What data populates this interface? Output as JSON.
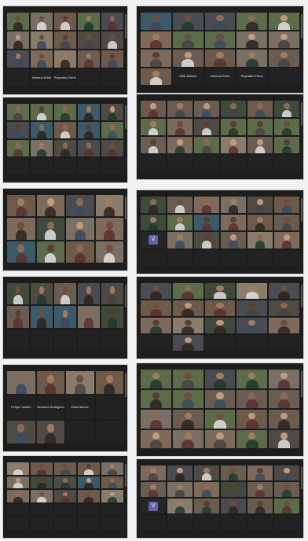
{
  "panels": [
    {
      "id": "p1",
      "cols": 5,
      "rows": 4,
      "tiles": [
        {
          "name": ""
        },
        {
          "name": ""
        },
        {
          "name": ""
        },
        {
          "name": ""
        },
        {
          "name": ""
        },
        {
          "name": ""
        },
        {
          "name": ""
        },
        {
          "name": ""
        },
        {
          "name": ""
        },
        {
          "name": ""
        },
        {
          "name": ""
        },
        {
          "name": ""
        },
        {
          "name": ""
        },
        {
          "name": ""
        },
        {
          "name": ""
        },
        {
          "name": "",
          "style": "dark"
        },
        {
          "name": "Nnenna Edeh",
          "style": "dark"
        },
        {
          "name": "Reynaldo Fierro",
          "style": "dark"
        },
        {
          "name": "",
          "style": "dark"
        },
        {
          "name": "",
          "style": "dark"
        }
      ],
      "caption": ""
    },
    {
      "id": "p2",
      "cols": 5,
      "rows": 4,
      "tiles": [
        {
          "name": ""
        },
        {
          "name": ""
        },
        {
          "name": ""
        },
        {
          "name": ""
        },
        {
          "name": ""
        },
        {
          "name": ""
        },
        {
          "name": ""
        },
        {
          "name": ""
        },
        {
          "name": ""
        },
        {
          "name": ""
        },
        {
          "name": ""
        },
        {
          "name": ""
        },
        {
          "name": ""
        },
        {
          "name": ""
        },
        {
          "name": ""
        },
        {
          "name": ""
        },
        {
          "name": "Gleb Azimov",
          "style": "dark"
        },
        {
          "name": "Nnenna Edeh",
          "style": "dark"
        },
        {
          "name": "Reynaldo Fierro",
          "style": "dark"
        },
        {
          "name": "",
          "style": "dark"
        }
      ],
      "caption": ""
    },
    {
      "id": "p3",
      "cols": 5,
      "rows": 4,
      "tiles": [
        {
          "name": ""
        },
        {
          "name": ""
        },
        {
          "name": ""
        },
        {
          "name": ""
        },
        {
          "name": ""
        },
        {
          "name": ""
        },
        {
          "name": ""
        },
        {
          "name": ""
        },
        {
          "name": ""
        },
        {
          "name": ""
        },
        {
          "name": ""
        },
        {
          "name": ""
        },
        {
          "name": ""
        },
        {
          "name": ""
        },
        {
          "name": ""
        },
        {
          "name": "",
          "style": "dark"
        },
        {
          "name": "",
          "style": "dark"
        },
        {
          "name": "",
          "style": "dark"
        },
        {
          "name": "",
          "style": "dark"
        },
        {
          "name": "",
          "style": "dark"
        }
      ],
      "caption": ""
    },
    {
      "id": "p4",
      "cols": 6,
      "rows": 4,
      "tiles": [
        {
          "name": ""
        },
        {
          "name": ""
        },
        {
          "name": ""
        },
        {
          "name": ""
        },
        {
          "name": ""
        },
        {
          "name": ""
        },
        {
          "name": ""
        },
        {
          "name": ""
        },
        {
          "name": ""
        },
        {
          "name": ""
        },
        {
          "name": ""
        },
        {
          "name": ""
        },
        {
          "name": ""
        },
        {
          "name": ""
        },
        {
          "name": ""
        },
        {
          "name": ""
        },
        {
          "name": ""
        },
        {
          "name": ""
        },
        {
          "name": "",
          "style": "dark"
        },
        {
          "name": "",
          "style": "dark"
        },
        {
          "name": "",
          "style": "dark"
        },
        {
          "name": "",
          "style": "dark"
        },
        {
          "name": "",
          "style": "dark"
        },
        {
          "name": "",
          "style": "dark"
        }
      ],
      "caption": ""
    },
    {
      "id": "p5",
      "cols": 4,
      "rows": 3,
      "tiles": [
        {
          "name": ""
        },
        {
          "name": ""
        },
        {
          "name": ""
        },
        {
          "name": ""
        },
        {
          "name": ""
        },
        {
          "name": ""
        },
        {
          "name": ""
        },
        {
          "name": ""
        },
        {
          "name": ""
        },
        {
          "name": ""
        },
        {
          "name": ""
        },
        {
          "name": ""
        }
      ],
      "caption": ""
    },
    {
      "id": "p6",
      "cols": 6,
      "rows": 4,
      "tiles": [
        {
          "name": ""
        },
        {
          "name": ""
        },
        {
          "name": ""
        },
        {
          "name": ""
        },
        {
          "name": ""
        },
        {
          "name": ""
        },
        {
          "name": ""
        },
        {
          "name": ""
        },
        {
          "name": ""
        },
        {
          "name": ""
        },
        {
          "name": ""
        },
        {
          "name": ""
        },
        {
          "name": "",
          "style": "avatar",
          "badge": "V"
        },
        {
          "name": ""
        },
        {
          "name": ""
        },
        {
          "name": ""
        },
        {
          "name": ""
        },
        {
          "name": ""
        },
        {
          "name": "",
          "style": "dark"
        },
        {
          "name": "",
          "style": "dark"
        },
        {
          "name": "",
          "style": "dark"
        },
        {
          "name": "",
          "style": "dark"
        },
        {
          "name": "",
          "style": "dark"
        },
        {
          "name": "",
          "style": "dark"
        }
      ],
      "caption": ""
    },
    {
      "id": "p7",
      "cols": 5,
      "rows": 3,
      "tiles": [
        {
          "name": ""
        },
        {
          "name": ""
        },
        {
          "name": ""
        },
        {
          "name": ""
        },
        {
          "name": ""
        },
        {
          "name": ""
        },
        {
          "name": ""
        },
        {
          "name": ""
        },
        {
          "name": ""
        },
        {
          "name": ""
        },
        {
          "name": "",
          "style": "dark"
        },
        {
          "name": "",
          "style": "dark"
        },
        {
          "name": "",
          "style": "dark"
        },
        {
          "name": "",
          "style": "dark"
        },
        {
          "name": "",
          "style": "dark"
        }
      ],
      "caption": ""
    },
    {
      "id": "p8",
      "cols": 5,
      "rows": 4,
      "tiles": [
        {
          "name": ""
        },
        {
          "name": ""
        },
        {
          "name": ""
        },
        {
          "name": ""
        },
        {
          "name": ""
        },
        {
          "name": ""
        },
        {
          "name": ""
        },
        {
          "name": ""
        },
        {
          "name": ""
        },
        {
          "name": ""
        },
        {
          "name": ""
        },
        {
          "name": ""
        },
        {
          "name": ""
        },
        {
          "name": ""
        },
        {
          "name": ""
        },
        {
          "name": "",
          "style": "dark"
        },
        {
          "name": ""
        },
        {
          "name": "",
          "style": "dark"
        },
        {
          "name": "",
          "style": "dark"
        },
        {
          "name": "",
          "style": "dark"
        }
      ],
      "caption": ""
    },
    {
      "id": "p9",
      "cols": 4,
      "rows": 3,
      "tiles": [
        {
          "name": ""
        },
        {
          "name": ""
        },
        {
          "name": ""
        },
        {
          "name": ""
        },
        {
          "name": "Felipe Castillo",
          "style": "dark"
        },
        {
          "name": "Veronica Rodriguez",
          "style": "dark"
        },
        {
          "name": "Erika Ibanez",
          "style": "dark"
        },
        {
          "name": "",
          "style": "dark"
        },
        {
          "name": ""
        },
        {
          "name": ""
        },
        {
          "name": "",
          "style": "dark"
        },
        {
          "name": "",
          "style": "dark"
        }
      ],
      "caption": ""
    },
    {
      "id": "p10",
      "cols": 5,
      "rows": 4,
      "tiles": [
        {
          "name": ""
        },
        {
          "name": ""
        },
        {
          "name": ""
        },
        {
          "name": ""
        },
        {
          "name": ""
        },
        {
          "name": ""
        },
        {
          "name": ""
        },
        {
          "name": ""
        },
        {
          "name": ""
        },
        {
          "name": ""
        },
        {
          "name": ""
        },
        {
          "name": ""
        },
        {
          "name": ""
        },
        {
          "name": ""
        },
        {
          "name": ""
        },
        {
          "name": ""
        },
        {
          "name": ""
        },
        {
          "name": ""
        },
        {
          "name": ""
        },
        {
          "name": ""
        }
      ],
      "caption": ""
    },
    {
      "id": "p11",
      "cols": 5,
      "rows": 5,
      "tiles": [
        {
          "name": ""
        },
        {
          "name": ""
        },
        {
          "name": ""
        },
        {
          "name": ""
        },
        {
          "name": ""
        },
        {
          "name": ""
        },
        {
          "name": ""
        },
        {
          "name": ""
        },
        {
          "name": ""
        },
        {
          "name": ""
        },
        {
          "name": ""
        },
        {
          "name": ""
        },
        {
          "name": ""
        },
        {
          "name": ""
        },
        {
          "name": ""
        },
        {
          "name": "",
          "style": "dark"
        },
        {
          "name": "",
          "style": "dark"
        },
        {
          "name": "",
          "style": "dark"
        },
        {
          "name": "",
          "style": "dark"
        },
        {
          "name": "",
          "style": "dark"
        },
        {
          "name": "",
          "style": "dark"
        },
        {
          "name": "",
          "style": "dark"
        },
        {
          "name": "",
          "style": "dark"
        },
        {
          "name": "",
          "style": "dark"
        },
        {
          "name": "",
          "style": "dark"
        }
      ],
      "caption": ""
    },
    {
      "id": "p12",
      "cols": 6,
      "rows": 4,
      "tiles": [
        {
          "name": ""
        },
        {
          "name": ""
        },
        {
          "name": ""
        },
        {
          "name": ""
        },
        {
          "name": ""
        },
        {
          "name": ""
        },
        {
          "name": ""
        },
        {
          "name": ""
        },
        {
          "name": ""
        },
        {
          "name": ""
        },
        {
          "name": ""
        },
        {
          "name": ""
        },
        {
          "name": "",
          "style": "avatar",
          "badge": "V"
        },
        {
          "name": ""
        },
        {
          "name": ""
        },
        {
          "name": ""
        },
        {
          "name": ""
        },
        {
          "name": ""
        },
        {
          "name": "",
          "style": "dark"
        },
        {
          "name": "",
          "style": "dark"
        },
        {
          "name": "",
          "style": "dark"
        },
        {
          "name": "",
          "style": "dark"
        },
        {
          "name": "",
          "style": "dark"
        },
        {
          "name": "",
          "style": "dark"
        }
      ],
      "caption": ""
    }
  ],
  "colors": {
    "panel_bg": "#1d1d1d",
    "page_bg": "#f2f2f2",
    "avatar_badge": "#6264a7",
    "tile_palette": [
      "#6d5a4a",
      "#4f4a44",
      "#7a6f63",
      "#3f4a3c",
      "#5c6b4a",
      "#8a7c6a",
      "#4a4a52",
      "#6b5c52",
      "#3d5a6b",
      "#7d6a5a"
    ]
  }
}
